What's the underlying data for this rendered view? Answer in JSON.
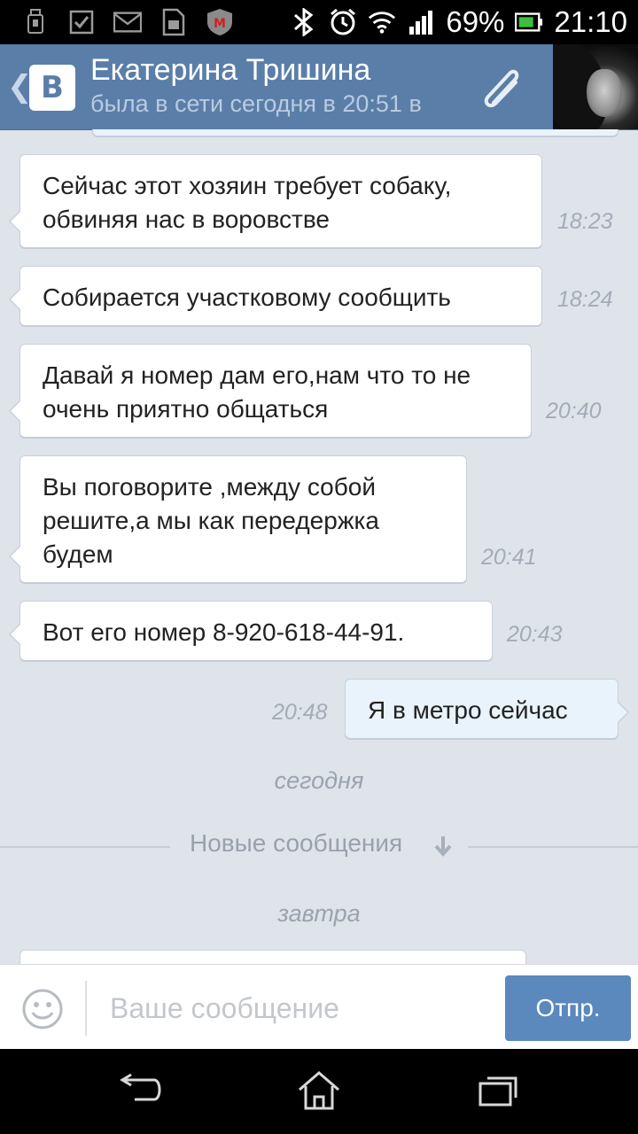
{
  "status_bar": {
    "battery_percent": "69%",
    "time": "21:10",
    "icons": [
      "usb-debug-icon",
      "checkbox-icon",
      "mail-icon",
      "sim-card-icon",
      "mcafee-icon",
      "bluetooth-icon",
      "alarm-icon",
      "wifi-icon",
      "signal-icon",
      "battery-icon"
    ]
  },
  "header": {
    "logo_letter": "В",
    "contact_name": "Екатерина Тришина",
    "contact_status": "была в сети сегодня в 20:51 в",
    "back_glyph": "❮",
    "colors": {
      "bar": "#5a7ea8",
      "status_text": "#b9cbe0"
    }
  },
  "messages": [
    {
      "direction": "in",
      "text": "Сейчас этот хозяин требует собаку, обвиняя нас в воровстве",
      "time": "18:23"
    },
    {
      "direction": "in",
      "text": "Собирается участковому сообщить",
      "time": "18:24"
    },
    {
      "direction": "in",
      "text": "Давай я номер дам его,нам что то не очень приятно общаться",
      "time": "20:40"
    },
    {
      "direction": "in",
      "text": "Вы поговорите ,между собой решите,а мы как передержка будем",
      "time": "20:41"
    },
    {
      "direction": "in",
      "text": "Вот его номер 8-920-618-44-91.",
      "time": "20:43"
    },
    {
      "direction": "out",
      "text": "Я в метро сейчас",
      "time": "20:48"
    }
  ],
  "separators": {
    "today": "сегодня",
    "new_messages": "Новые сообщения",
    "tomorrow": "завтра"
  },
  "composer": {
    "placeholder": "Ваше сообщение",
    "send_label": "Отпр."
  },
  "navigation": {
    "icons": [
      "back-nav-icon",
      "home-nav-icon",
      "recent-apps-icon"
    ]
  }
}
